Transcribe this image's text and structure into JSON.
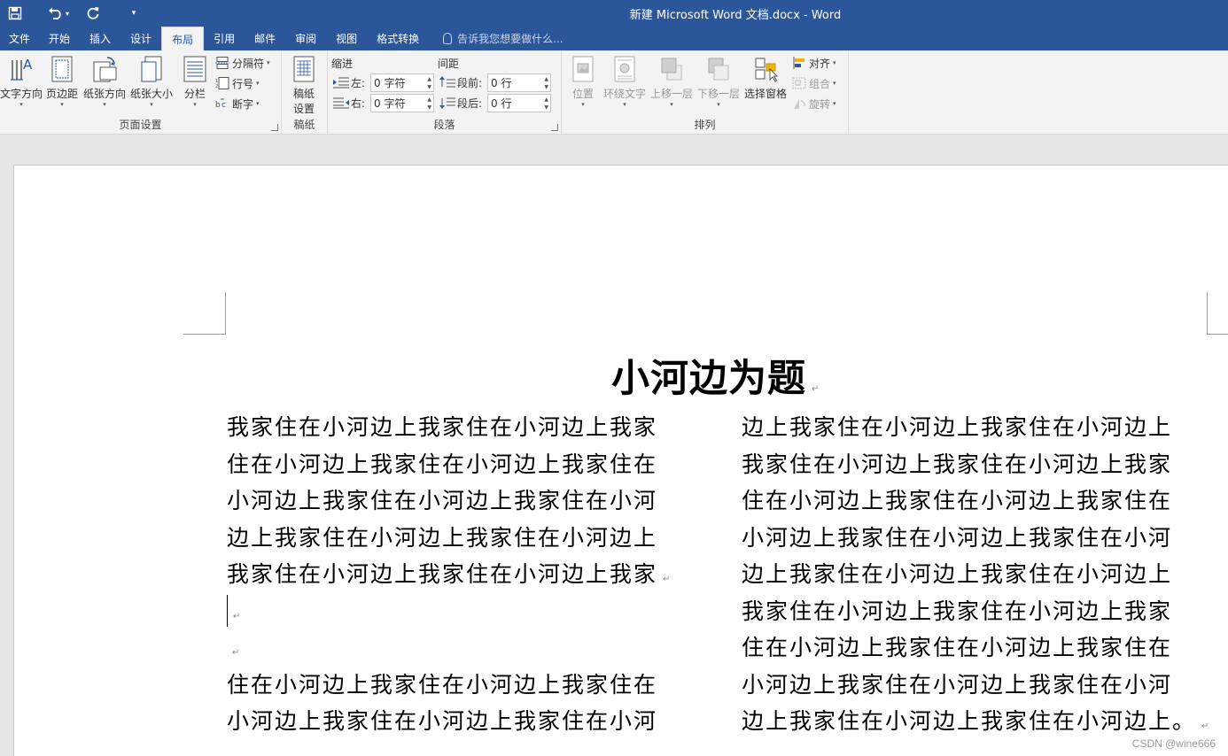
{
  "window": {
    "title": "新建 Microsoft Word 文档.docx - Word"
  },
  "qat": {
    "save_icon": "save-icon",
    "undo_icon": "undo-icon",
    "redo_icon": "redo-icon",
    "customize_icon": "customize-qat-icon"
  },
  "tabs": [
    {
      "label": "文件"
    },
    {
      "label": "开始"
    },
    {
      "label": "插入"
    },
    {
      "label": "设计"
    },
    {
      "label": "布局",
      "active": true
    },
    {
      "label": "引用"
    },
    {
      "label": "邮件"
    },
    {
      "label": "审阅"
    },
    {
      "label": "视图"
    },
    {
      "label": "格式转换"
    }
  ],
  "tellme": {
    "placeholder": "告诉我您想要做什么..."
  },
  "ribbon": {
    "page_setup": {
      "label": "页面设置",
      "text_direction": "文字方向",
      "margins": "页边距",
      "orientation": "纸张方向",
      "size": "纸张大小",
      "columns": "分栏",
      "breaks": "分隔符",
      "line_numbers": "行号",
      "hyphenation": "断字"
    },
    "manuscript": {
      "label": "稿纸",
      "button_line1": "稿纸",
      "button_line2": "设置"
    },
    "paragraph": {
      "label": "段落",
      "indent_heading": "缩进",
      "spacing_heading": "间距",
      "indent_left_label": "左:",
      "indent_left_value": "0 字符",
      "indent_right_label": "右:",
      "indent_right_value": "0 字符",
      "spacing_before_label": "段前:",
      "spacing_before_value": "0 行",
      "spacing_after_label": "段后:",
      "spacing_after_value": "0 行"
    },
    "arrange": {
      "label": "排列",
      "position": "位置",
      "wrap_text": "环绕文字",
      "bring_forward": "上移一层",
      "send_backward": "下移一层",
      "selection_pane": "选择窗格",
      "align": "对齐",
      "group": "组合",
      "rotate": "旋转"
    }
  },
  "document": {
    "title": "小河边为题",
    "left_column": [
      "我家住在小河边上我家住在小河边上我家",
      "住在小河边上我家住在小河边上我家住在",
      "小河边上我家住在小河边上我家住在小河",
      "边上我家住在小河边上我家住在小河边上",
      "我家住在小河边上我家住在小河边上我家",
      "",
      "",
      "住在小河边上我家住在小河边上我家住在",
      "小河边上我家住在小河边上我家住在小河"
    ],
    "right_column": [
      "边上我家住在小河边上我家住在小河边上",
      "我家住在小河边上我家住在小河边上我家",
      "住在小河边上我家住在小河边上我家住在",
      "小河边上我家住在小河边上我家住在小河",
      "边上我家住在小河边上我家住在小河边上",
      "我家住在小河边上我家住在小河边上我家",
      "住在小河边上我家住在小河边上我家住在",
      "小河边上我家住在小河边上我家住在小河",
      "边上我家住在小河边上我家住在小河边上。"
    ],
    "paragraph_mark": "↵"
  },
  "watermark": "CSDN @wine666",
  "colors": {
    "title_bar": "#2b579a",
    "ribbon_bg": "#f3f3f3",
    "workspace_bg": "#e6e6e6"
  }
}
